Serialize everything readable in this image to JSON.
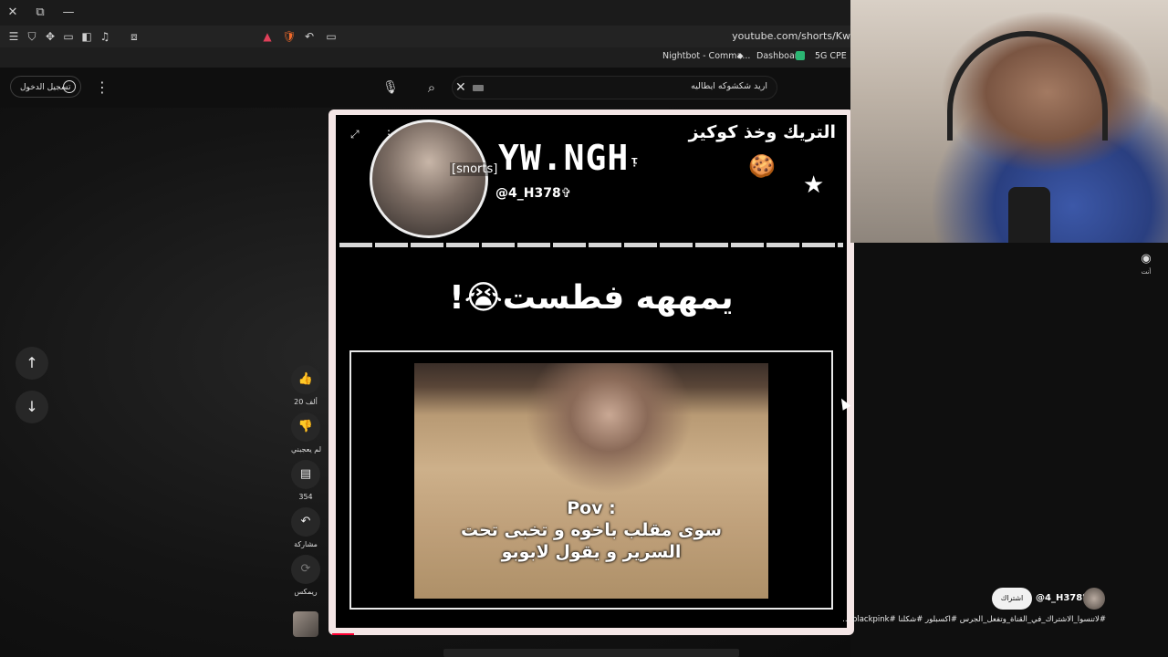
{
  "browser": {
    "url": "youtube.com/shorts/Kw",
    "bookmarks": [
      "Nightbot - Comma...",
      "Dashboard",
      "5G CPE"
    ],
    "win_close": "✕",
    "win_restore": "⧉",
    "win_min": "—"
  },
  "header": {
    "signin_label": "تسجيل الدخول",
    "search_query": "اريد شكشوكه ايطاليه",
    "clear": "✕",
    "more": "⋮"
  },
  "short": {
    "snorts_label": "[snorts]",
    "brand_text": "YW.NGH",
    "brand_mark": "ᵎ",
    "handle": "@4_H378✞",
    "top_arabic": "التريك وخذ كوكيز",
    "cookie": "🍪",
    "stars": "★",
    "cc_label": "CC",
    "headline": "يمههه فطست😭!",
    "pov_line1": "Pov :",
    "pov_line2": "سوى مقلب باخوه و تخبى تحت",
    "pov_line3": "السرير و يقول لابوبو"
  },
  "actions": {
    "like_count": "20 ألف",
    "dislike_label": "لم يعجبني",
    "comments_count": "354",
    "share_label": "مشاركة",
    "remix_label": "ريمكس"
  },
  "sidebar_right": {
    "you_label": "أنت"
  },
  "channel": {
    "name": "@4_H378؟",
    "subscribe_label": "اشتراك",
    "description": "#لاتنسوا_الاشتراك_في_القناة_وتفعل_الجرس #اكسبلور #شكلنا #blackpink ..."
  },
  "colors": {
    "accent": "#ff0033",
    "page_bg": "#0f0f0f",
    "frame": "#f4e6e6"
  }
}
